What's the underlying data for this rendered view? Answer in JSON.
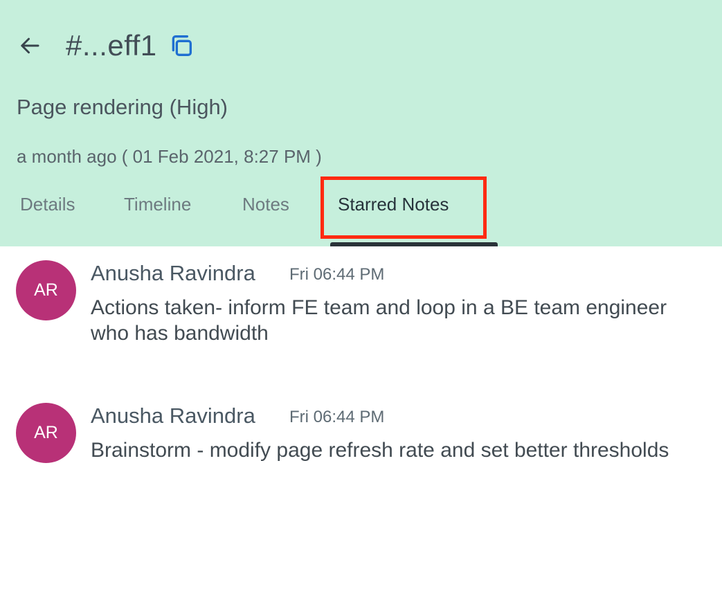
{
  "header": {
    "incident_id": "#...eff1",
    "subtitle": "Page rendering (High)",
    "time": "a month ago ( 01 Feb 2021, 8:27 PM )",
    "back_icon": "arrow-left-icon",
    "copy_icon": "copy-icon"
  },
  "tabs": [
    {
      "label": "Details"
    },
    {
      "label": "Timeline"
    },
    {
      "label": "Notes"
    },
    {
      "label": "Starred Notes",
      "active": true
    }
  ],
  "notes": [
    {
      "avatar_initials": "AR",
      "author": "Anusha Ravindra",
      "time": "Fri 06:44 PM",
      "text": "Actions taken- inform FE team and loop in a BE team engineer who has bandwidth"
    },
    {
      "avatar_initials": "AR",
      "author": "Anusha Ravindra",
      "time": "Fri 06:44 PM",
      "text": "Brainstorm - modify page refresh rate and set better thresholds"
    }
  ],
  "colors": {
    "header_bg": "#c6efdc",
    "avatar": "#b83177",
    "copy_icon": "#1f6fd1",
    "highlight": "#ff2a12"
  }
}
